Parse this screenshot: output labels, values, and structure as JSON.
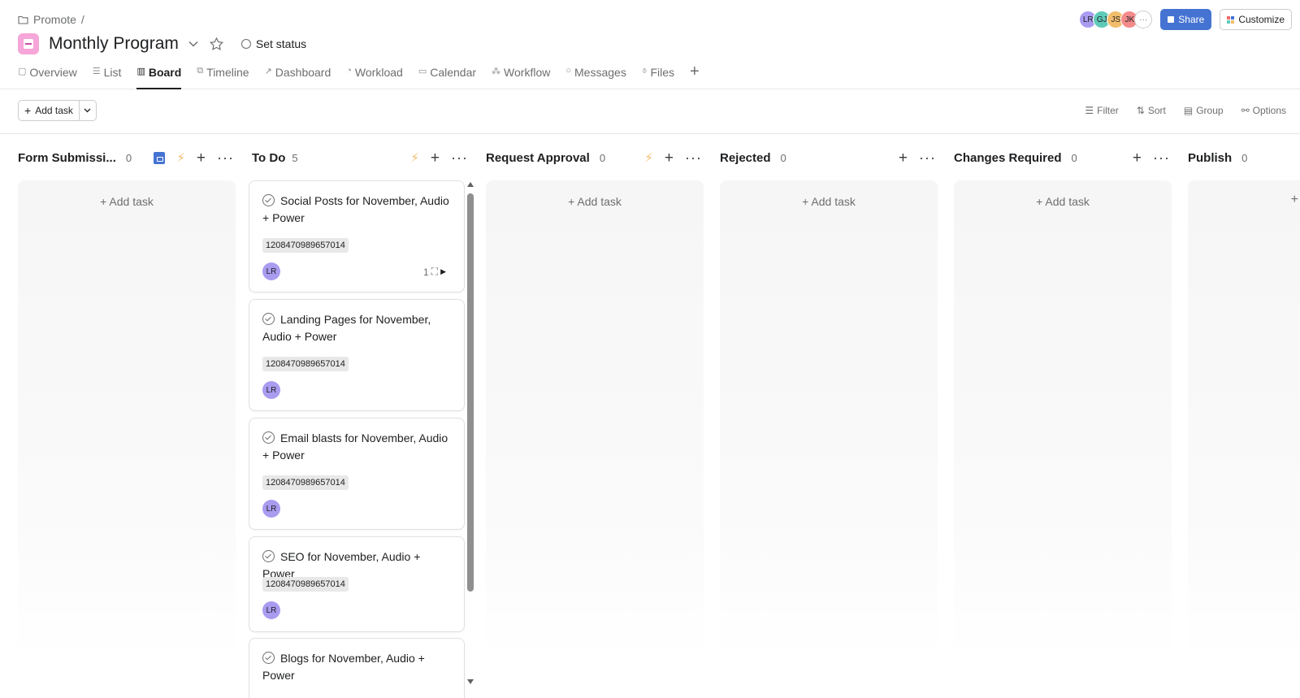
{
  "breadcrumb": {
    "parent": "Promote",
    "separator": "/"
  },
  "project": {
    "title": "Monthly Program",
    "set_status": "Set status",
    "icon_color": "#f6a6d8"
  },
  "tabs": [
    {
      "label": "Overview",
      "icon": "overview-icon"
    },
    {
      "label": "List",
      "icon": "list-icon"
    },
    {
      "label": "Board",
      "icon": "board-icon",
      "active": true
    },
    {
      "label": "Timeline",
      "icon": "timeline-icon"
    },
    {
      "label": "Dashboard",
      "icon": "dashboard-icon"
    },
    {
      "label": "Workload",
      "icon": "workload-icon"
    },
    {
      "label": "Calendar",
      "icon": "calendar-icon"
    },
    {
      "label": "Workflow",
      "icon": "workflow-icon"
    },
    {
      "label": "Messages",
      "icon": "messages-icon"
    },
    {
      "label": "Files",
      "icon": "files-icon"
    }
  ],
  "header": {
    "avatars": [
      {
        "initials": "LR",
        "color": "#a99cf0"
      },
      {
        "initials": "GJ",
        "color": "#5fcab8"
      },
      {
        "initials": "JS",
        "color": "#f1bd6c"
      },
      {
        "initials": "JK",
        "color": "#f48a8a"
      }
    ],
    "more": "···",
    "share_label": "Share",
    "customize_label": "Customize",
    "accent": "#4573d2"
  },
  "toolbar": {
    "add_task_label": "Add task",
    "filter": "Filter",
    "sort": "Sort",
    "group": "Group",
    "options": "Options"
  },
  "columns": [
    {
      "title": "Form Submissi...",
      "count": "0",
      "add_task": "+ Add task"
    },
    {
      "title": "To Do",
      "count": "5"
    },
    {
      "title": "Request Approval",
      "count": "0",
      "add_task": "+ Add task"
    },
    {
      "title": "Rejected",
      "count": "0",
      "add_task": "+ Add task"
    },
    {
      "title": "Changes Required",
      "count": "0",
      "add_task": "+ Add task"
    },
    {
      "title": "Publish",
      "count": "0",
      "add_task": "+"
    }
  ],
  "cards": [
    {
      "title": "Social Posts for November, Audio + Power",
      "tag": "1208470989657014",
      "assignee": "LR",
      "subtasks": "1"
    },
    {
      "title": "Landing Pages for November, Audio + Power",
      "tag": "1208470989657014",
      "assignee": "LR"
    },
    {
      "title": "Email blasts for November, Audio + Power",
      "tag": "1208470989657014",
      "assignee": "LR"
    },
    {
      "title": "SEO for November, Audio + Power",
      "tag": "1208470989657014",
      "assignee": "LR"
    },
    {
      "title": "Blogs for November, Audio + Power"
    }
  ]
}
